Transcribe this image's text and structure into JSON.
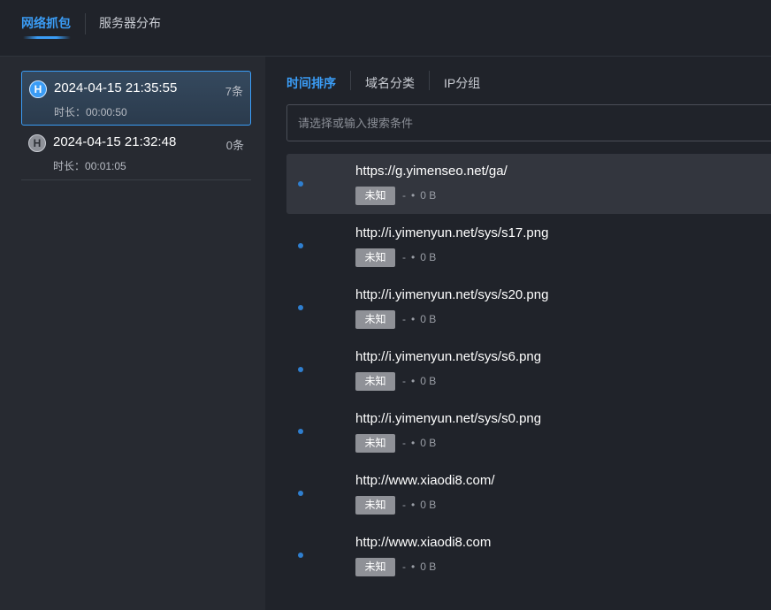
{
  "top_tabs": [
    {
      "label": "网络抓包"
    },
    {
      "label": "服务器分布"
    }
  ],
  "sessions": [
    {
      "icon": "H",
      "time": "2024-04-15 21:35:55",
      "count": "7条",
      "duration_label": "时长：",
      "duration": "00:00:50"
    },
    {
      "icon": "H",
      "time": "2024-04-15 21:32:48",
      "count": "0条",
      "duration_label": "时长：",
      "duration": "00:01:05"
    }
  ],
  "filter_tabs": [
    {
      "label": "时间排序"
    },
    {
      "label": "域名分类"
    },
    {
      "label": "IP分组"
    }
  ],
  "search": {
    "placeholder": "请选择或输入搜索条件"
  },
  "requests": [
    {
      "url": "https://g.yimenseo.net/ga/",
      "tag": "未知",
      "dash": "-",
      "bullet": "•",
      "size": "0 B"
    },
    {
      "url": "http://i.yimenyun.net/sys/s17.png",
      "tag": "未知",
      "dash": "-",
      "bullet": "•",
      "size": "0 B"
    },
    {
      "url": "http://i.yimenyun.net/sys/s20.png",
      "tag": "未知",
      "dash": "-",
      "bullet": "•",
      "size": "0 B"
    },
    {
      "url": "http://i.yimenyun.net/sys/s6.png",
      "tag": "未知",
      "dash": "-",
      "bullet": "•",
      "size": "0 B"
    },
    {
      "url": "http://i.yimenyun.net/sys/s0.png",
      "tag": "未知",
      "dash": "-",
      "bullet": "•",
      "size": "0 B"
    },
    {
      "url": "http://www.xiaodi8.com/",
      "tag": "未知",
      "dash": "-",
      "bullet": "•",
      "size": "0 B"
    },
    {
      "url": "http://www.xiaodi8.com",
      "tag": "未知",
      "dash": "-",
      "bullet": "•",
      "size": "0 B"
    }
  ]
}
